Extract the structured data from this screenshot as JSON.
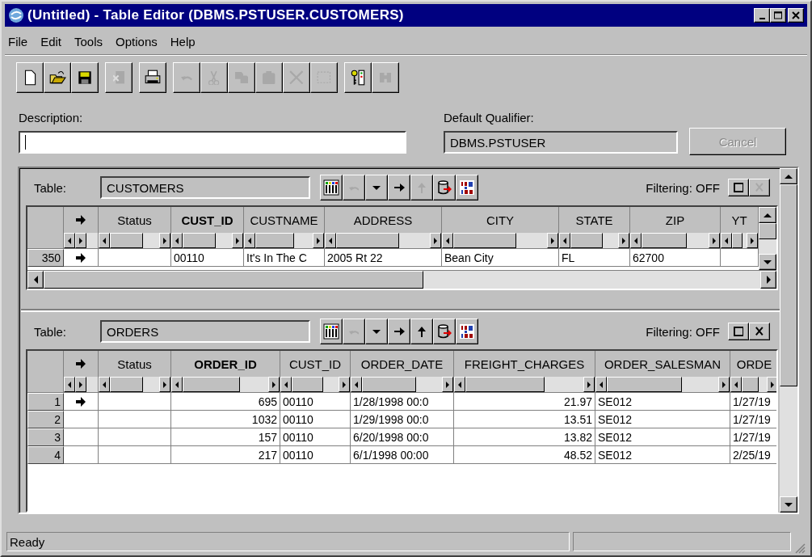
{
  "window": {
    "title": "(Untitled) - Table Editor (DBMS.PSTUSER.CUSTOMERS)"
  },
  "menu": [
    "File",
    "Edit",
    "Tools",
    "Options",
    "Help"
  ],
  "toolbar": [
    [
      {
        "kind": "new",
        "disabled": false
      },
      {
        "kind": "open",
        "disabled": false
      },
      {
        "kind": "save",
        "disabled": false
      }
    ],
    [
      {
        "kind": "extract",
        "disabled": true
      }
    ],
    [
      {
        "kind": "print",
        "disabled": false
      }
    ],
    [
      {
        "kind": "undo",
        "disabled": true
      },
      {
        "kind": "cut",
        "disabled": true
      },
      {
        "kind": "copy",
        "disabled": true
      },
      {
        "kind": "paste",
        "disabled": true
      },
      {
        "kind": "delete",
        "disabled": true
      },
      {
        "kind": "select",
        "disabled": true
      }
    ],
    [
      {
        "kind": "keylist",
        "disabled": false
      },
      {
        "kind": "find",
        "disabled": true
      }
    ]
  ],
  "description": {
    "label": "Description:",
    "focused": true
  },
  "qualifier": {
    "label": "Default Qualifier:",
    "value": "DBMS.PSTUSER"
  },
  "cancel": {
    "label": "Cancel",
    "disabled": true
  },
  "panes": [
    {
      "label": "Table:",
      "table": "CUSTOMERS",
      "tools": [
        {
          "kind": "columns",
          "disabled": false
        },
        {
          "kind": "undo",
          "disabled": true
        },
        {
          "kind": "dropdown",
          "disabled": false
        },
        {
          "kind": "right",
          "disabled": false
        },
        {
          "kind": "up",
          "disabled": true
        },
        {
          "kind": "export",
          "disabled": false
        },
        {
          "kind": "sort",
          "disabled": false
        }
      ],
      "filtering": "Filtering: OFF",
      "filter_buttons": [
        {
          "kind": "box",
          "disabled": false
        },
        {
          "kind": "close",
          "disabled": true
        }
      ],
      "columns": [
        {
          "label": "Status",
          "key": false
        },
        {
          "label": "CUST_ID",
          "key": true,
          "numeric": false
        },
        {
          "label": "CUSTNAME",
          "key": false,
          "numeric": false
        },
        {
          "label": "ADDRESS",
          "key": false,
          "numeric": false
        },
        {
          "label": "CITY",
          "key": false,
          "numeric": false
        },
        {
          "label": "STATE",
          "key": false,
          "numeric": false
        },
        {
          "label": "ZIP",
          "key": false,
          "numeric": false
        },
        {
          "label": "YT",
          "key": false
        }
      ],
      "rows": [
        {
          "header": "350",
          "current": true,
          "cells": [
            null,
            "00110",
            "It's In The C",
            "2005 Rt 22",
            "Bean City",
            "FL",
            "62700",
            null
          ]
        }
      ]
    },
    {
      "label": "Table:",
      "table": "ORDERS",
      "tools": [
        {
          "kind": "columns",
          "disabled": false
        },
        {
          "kind": "undo",
          "disabled": true
        },
        {
          "kind": "dropdown",
          "disabled": false
        },
        {
          "kind": "right",
          "disabled": false
        },
        {
          "kind": "up",
          "disabled": false
        },
        {
          "kind": "export",
          "disabled": false
        },
        {
          "kind": "sort",
          "disabled": false
        }
      ],
      "filtering": "Filtering: OFF",
      "filter_buttons": [
        {
          "kind": "box",
          "disabled": false
        },
        {
          "kind": "close",
          "disabled": false
        }
      ],
      "columns": [
        {
          "label": "Status",
          "key": false
        },
        {
          "label": "ORDER_ID",
          "key": true,
          "numeric": true
        },
        {
          "label": "CUST_ID",
          "key": false,
          "numeric": false
        },
        {
          "label": "ORDER_DATE",
          "key": false,
          "numeric": false
        },
        {
          "label": "FREIGHT_CHARGES",
          "key": false,
          "numeric": true
        },
        {
          "label": "ORDER_SALESMAN",
          "key": false,
          "numeric": false
        },
        {
          "label": "ORDE",
          "key": false,
          "numeric": false
        }
      ],
      "rows": [
        {
          "header": "1",
          "current": true,
          "cells": [
            null,
            "695",
            "00110",
            "1/28/1998 00:0",
            "21.97",
            "SE012",
            "1/27/19"
          ]
        },
        {
          "header": "2",
          "current": false,
          "cells": [
            null,
            "1032",
            "00110",
            "1/29/1998 00:0",
            "13.51",
            "SE012",
            "1/27/19"
          ]
        },
        {
          "header": "3",
          "current": false,
          "cells": [
            null,
            "157",
            "00110",
            "6/20/1998 00:0",
            "13.82",
            "SE012",
            "1/27/19"
          ]
        },
        {
          "header": "4",
          "current": false,
          "cells": [
            null,
            "217",
            "00110",
            "6/1/1998 00:00",
            "48.52",
            "SE012",
            "2/25/19"
          ]
        }
      ]
    }
  ],
  "status_bar": "Ready"
}
